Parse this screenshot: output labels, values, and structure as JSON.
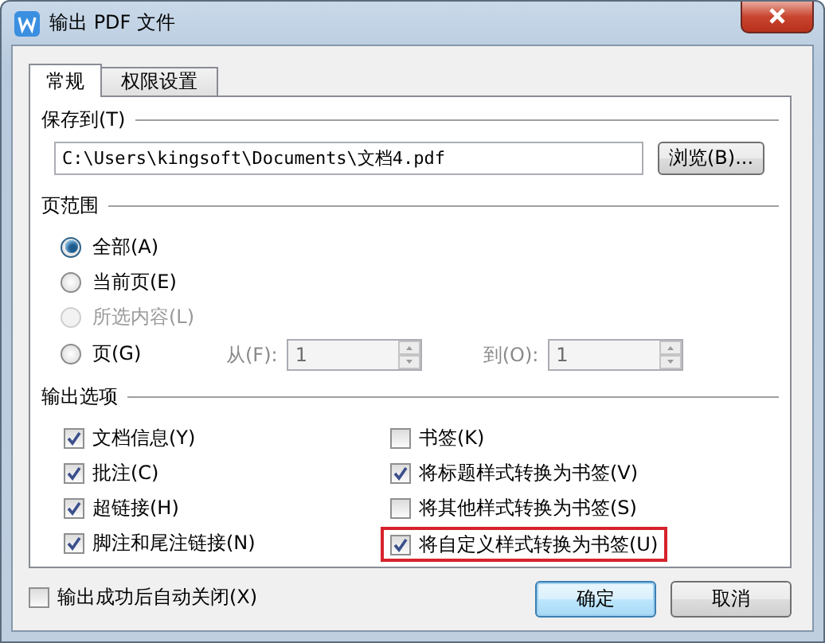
{
  "window": {
    "title": "输出 PDF 文件"
  },
  "tabs": [
    {
      "label": "常规",
      "selected": true
    },
    {
      "label": "权限设置",
      "selected": false
    }
  ],
  "save_to": {
    "label": "保存到(T)",
    "value": "C:\\Users\\kingsoft\\Documents\\文档4.pdf",
    "browse_button": "浏览(B)..."
  },
  "page_range": {
    "label": "页范围",
    "options": [
      {
        "label": "全部(A)",
        "selected": true,
        "disabled": false
      },
      {
        "label": "当前页(E)",
        "selected": false,
        "disabled": false
      },
      {
        "label": "所选内容(L)",
        "selected": false,
        "disabled": true
      },
      {
        "label": "页(G)",
        "selected": false,
        "disabled": false
      }
    ],
    "from": {
      "label": "从(F):",
      "value": "1",
      "disabled": true
    },
    "to": {
      "label": "到(O):",
      "value": "1",
      "disabled": true
    }
  },
  "output_options": {
    "label": "输出选项",
    "left": [
      {
        "label": "文档信息(Y)",
        "checked": true,
        "highlighted": false
      },
      {
        "label": "批注(C)",
        "checked": true,
        "highlighted": false
      },
      {
        "label": "超链接(H)",
        "checked": true,
        "highlighted": false
      },
      {
        "label": "脚注和尾注链接(N)",
        "checked": true,
        "highlighted": false
      }
    ],
    "right": [
      {
        "label": "书签(K)",
        "checked": false,
        "highlighted": false
      },
      {
        "label": "将标题样式转换为书签(V)",
        "checked": true,
        "highlighted": false
      },
      {
        "label": "将其他样式转换为书签(S)",
        "checked": false,
        "highlighted": false
      },
      {
        "label": "将自定义样式转换为书签(U)",
        "checked": true,
        "highlighted": true
      }
    ]
  },
  "auto_close": {
    "label": "输出成功后自动关闭(X)",
    "checked": false
  },
  "buttons": [
    {
      "label": "确定",
      "default": true
    },
    {
      "label": "取消",
      "default": false
    }
  ]
}
